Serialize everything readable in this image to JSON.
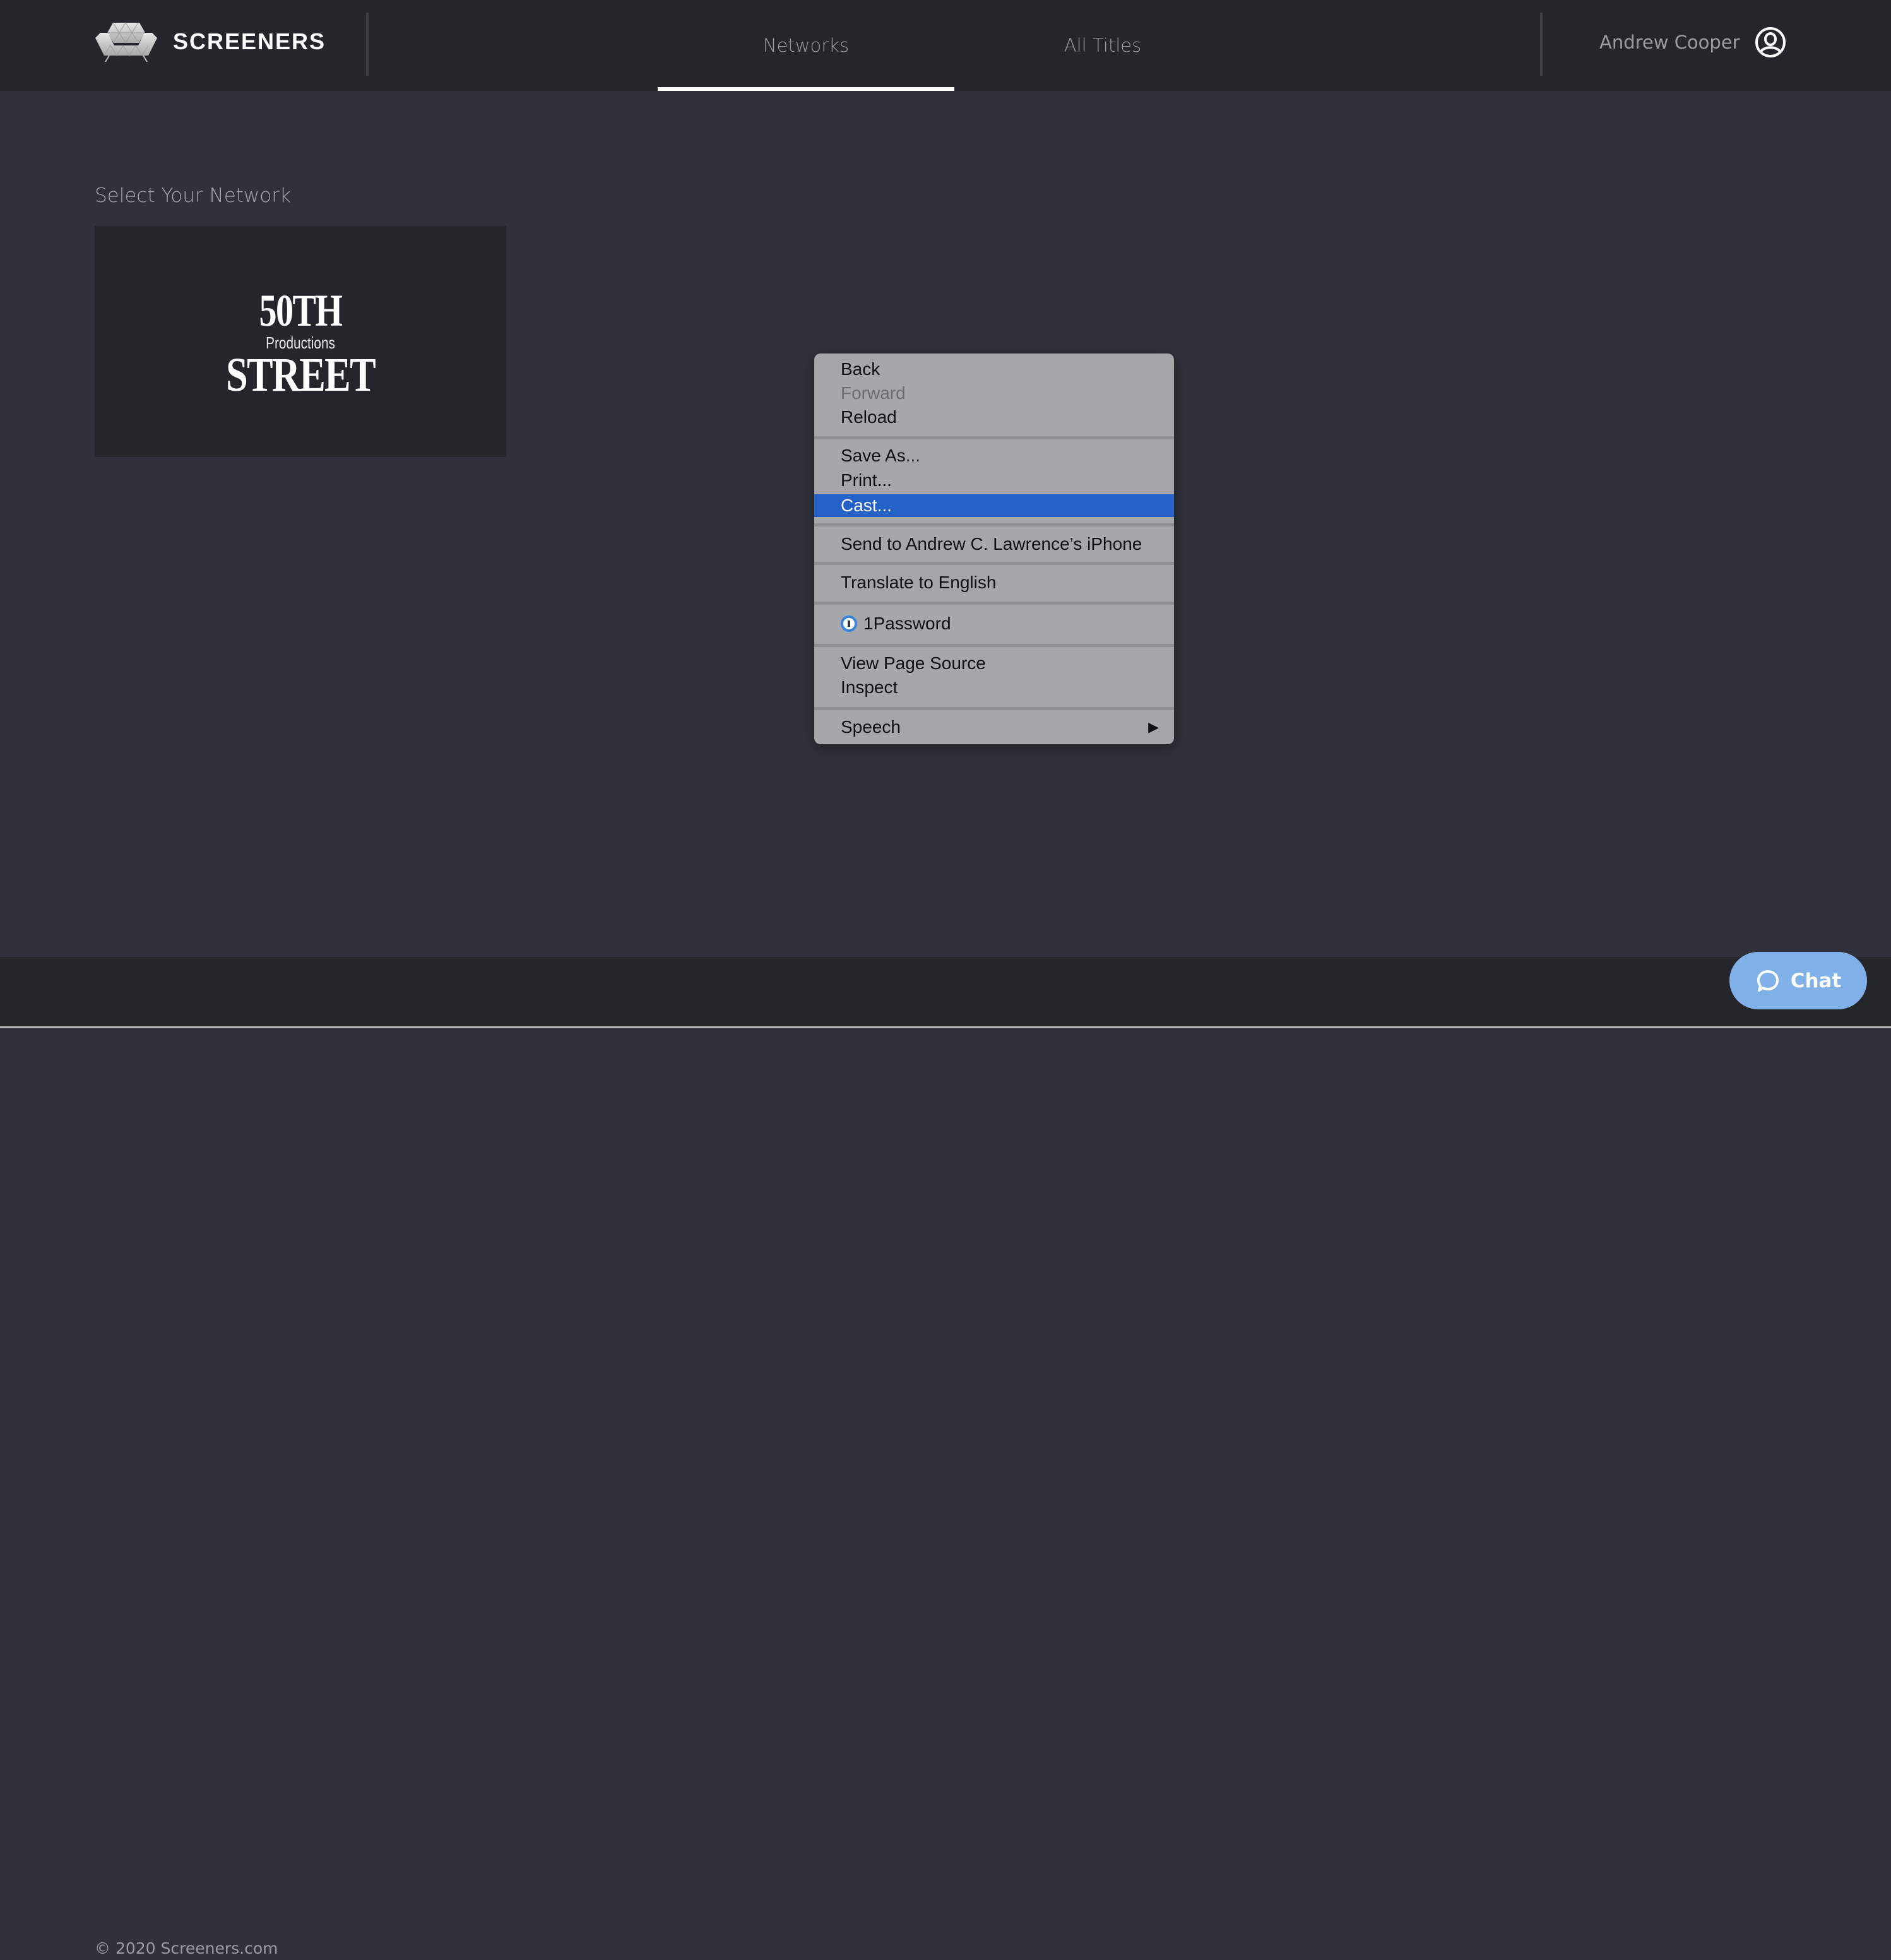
{
  "header": {
    "brand": "SCREENERS",
    "logo_icon": "sofa-logo-icon",
    "nav": [
      {
        "label": "Networks",
        "active": true
      },
      {
        "label": "All Titles",
        "active": false
      }
    ],
    "user_name": "Andrew Cooper",
    "user_icon": "user-circle-icon"
  },
  "main": {
    "section_title": "Select Your Network",
    "networks": [
      {
        "logo_line1": "50TH",
        "logo_line2": "Productions",
        "logo_line3": "STREET"
      }
    ]
  },
  "context_menu": {
    "items": [
      {
        "label": "Back",
        "enabled": true
      },
      {
        "label": "Forward",
        "enabled": false
      },
      {
        "label": "Reload",
        "enabled": true
      },
      {
        "label": "Save As...",
        "enabled": true
      },
      {
        "label": "Print...",
        "enabled": true
      },
      {
        "label": "Cast...",
        "enabled": true,
        "highlighted": true
      },
      {
        "label": "Send to Andrew C. Lawrence’s iPhone",
        "enabled": true
      },
      {
        "label": "Translate to English",
        "enabled": true
      },
      {
        "label": "1Password",
        "enabled": true,
        "icon": "1password-icon"
      },
      {
        "label": "View Page Source",
        "enabled": true
      },
      {
        "label": "Inspect",
        "enabled": true
      },
      {
        "label": "Speech",
        "enabled": true,
        "submenu": true
      }
    ],
    "submenu_arrow": "▶",
    "highlight_color": "#2461c6"
  },
  "footer": {
    "copyright": "© 2020 Screeners.com"
  },
  "chat": {
    "label": "Chat",
    "color": "#80b0e8"
  }
}
